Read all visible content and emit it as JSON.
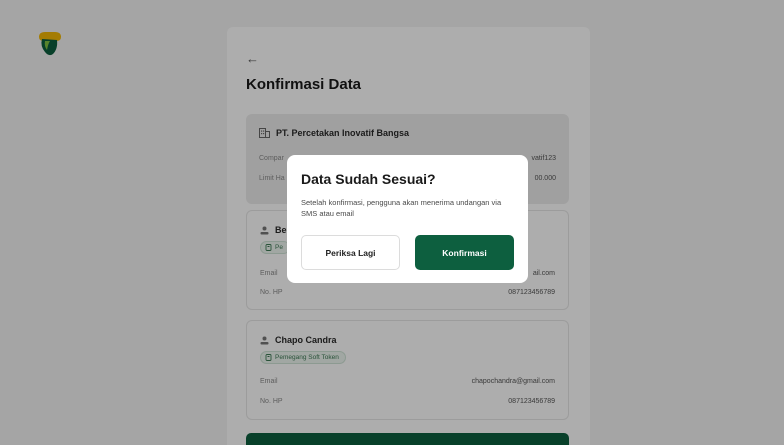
{
  "brand": {
    "logo_icon": "tree-logo-icon",
    "colors": {
      "green": "#0d5f3f",
      "gold": "#f2b705",
      "light_green": "#7fc242"
    }
  },
  "page": {
    "back_icon": "arrow-left-icon",
    "back_symbol": "←",
    "title": "Konfirmasi Data"
  },
  "company": {
    "icon": "building-icon",
    "name": "PT. Percetakan Inovatif Bangsa",
    "code_label": "Compar",
    "code_value": "vatif123",
    "limit_label": "Limit Ha",
    "limit_value": "00.000"
  },
  "users": [
    {
      "icon": "user-icon",
      "name": "Be",
      "role_icon": "token-icon",
      "role": "Pe",
      "email_label": "Email",
      "email_value": "ail.com",
      "phone_label": "No. HP",
      "phone_value": "087123456789"
    },
    {
      "icon": "user-icon",
      "name": "Chapo Candra",
      "role_icon": "token-icon",
      "role": "Pemegang Soft Token",
      "email_label": "Email",
      "email_value": "chapochandra@gmail.com",
      "phone_label": "No. HP",
      "phone_value": "087123456789"
    }
  ],
  "modal": {
    "title": "Data Sudah Sesuai?",
    "description": "Setelah konfirmasi, pengguna akan menerima undangan via SMS atau email",
    "secondary_label": "Periksa Lagi",
    "primary_label": "Konfirmasi"
  }
}
